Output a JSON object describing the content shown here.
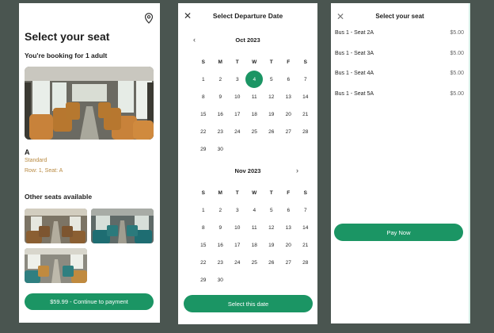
{
  "screen1": {
    "title": "Select your seat",
    "subtitle": "You're booking for 1 adult",
    "seat": {
      "name": "A",
      "class": "Standard",
      "position": "Row: 1, Seat: A"
    },
    "other_title": "Other seats available",
    "button": "$59.99 - Continue to payment"
  },
  "screen2": {
    "title": "Select Departure Date",
    "weekdays": [
      "S",
      "M",
      "T",
      "W",
      "T",
      "F",
      "S"
    ],
    "months": [
      {
        "label": "Oct 2023",
        "offset": 0,
        "days": 30,
        "selected": 4
      },
      {
        "label": "Nov 2023",
        "offset": 0,
        "days": 30,
        "selected": null
      }
    ],
    "button": "Select this date"
  },
  "screen3": {
    "title": "Select your seat",
    "seats": [
      {
        "label": "Bus 1 - Seat 2A",
        "price": "$5.00"
      },
      {
        "label": "Bus 1 - Seat 3A",
        "price": "$5.00"
      },
      {
        "label": "Bus 1 - Seat 4A",
        "price": "$5.00"
      },
      {
        "label": "Bus 1 - Seat 5A",
        "price": "$5.00"
      }
    ],
    "button": "Pay Now"
  },
  "colors": {
    "accent": "#1b9564",
    "seat_meta": "#b98a42",
    "background": "#4a5550"
  },
  "icons": [
    "location-pin-icon",
    "close-icon",
    "chevron-left-icon",
    "chevron-right-icon"
  ]
}
